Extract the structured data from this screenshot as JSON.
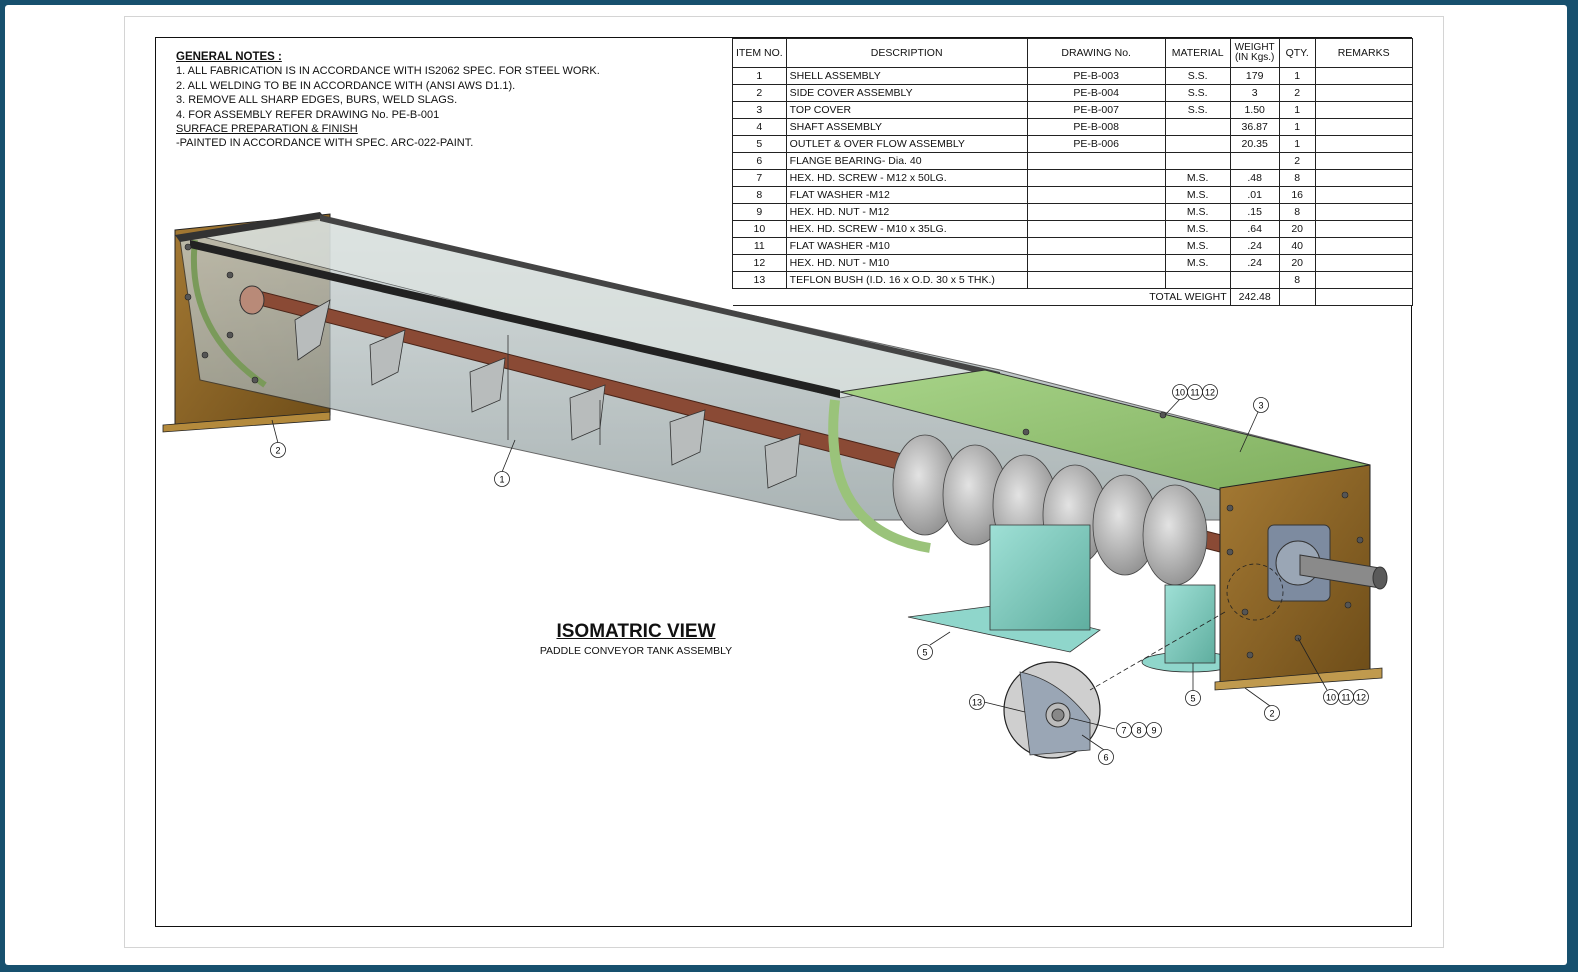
{
  "general_notes": {
    "heading": "GENERAL NOTES :",
    "items": [
      "1.  ALL FABRICATION IS IN ACCORDANCE WITH IS2062 SPEC. FOR STEEL WORK.",
      "2.  ALL WELDING TO BE IN ACCORDANCE WITH (ANSI AWS D1.1).",
      "3.  REMOVE ALL SHARP EDGES, BURS, WELD SLAGS.",
      "4.  FOR ASSEMBLY REFER DRAWING No. PE-B-001"
    ],
    "finish_heading": "SURFACE PREPARATION & FINISH",
    "finish_text": "-PAINTED IN ACCORDANCE WITH SPEC. ARC-022-PAINT."
  },
  "bom": {
    "headers": {
      "item": "ITEM NO.",
      "description": "DESCRIPTION",
      "drawing": "DRAWING No.",
      "material": "MATERIAL",
      "weight_1": "WEIGHT",
      "weight_2": "(IN Kgs.)",
      "qty": "QTY.",
      "remarks": "REMARKS"
    },
    "rows": [
      {
        "item": "1",
        "description": "SHELL ASSEMBLY",
        "drawing": "PE-B-003",
        "material": "S.S.",
        "weight": "179",
        "qty": "1",
        "remarks": ""
      },
      {
        "item": "2",
        "description": "SIDE COVER ASSEMBLY",
        "drawing": "PE-B-004",
        "material": "S.S.",
        "weight": "3",
        "qty": "2",
        "remarks": ""
      },
      {
        "item": "3",
        "description": "TOP COVER",
        "drawing": "PE-B-007",
        "material": "S.S.",
        "weight": "1.50",
        "qty": "1",
        "remarks": ""
      },
      {
        "item": "4",
        "description": "SHAFT ASSEMBLY",
        "drawing": "PE-B-008",
        "material": "",
        "weight": "36.87",
        "qty": "1",
        "remarks": ""
      },
      {
        "item": "5",
        "description": "OUTLET & OVER FLOW ASSEMBLY",
        "drawing": "PE-B-006",
        "material": "",
        "weight": "20.35",
        "qty": "1",
        "remarks": ""
      },
      {
        "item": "6",
        "description": "FLANGE BEARING- Dia. 40",
        "drawing": "",
        "material": "",
        "weight": "",
        "qty": "2",
        "remarks": ""
      },
      {
        "item": "7",
        "description": "HEX. HD. SCREW - M12 x 50LG.",
        "drawing": "",
        "material": "M.S.",
        "weight": ".48",
        "qty": "8",
        "remarks": ""
      },
      {
        "item": "8",
        "description": "FLAT WASHER -M12",
        "drawing": "",
        "material": "M.S.",
        "weight": ".01",
        "qty": "16",
        "remarks": ""
      },
      {
        "item": "9",
        "description": "HEX. HD. NUT - M12",
        "drawing": "",
        "material": "M.S.",
        "weight": ".15",
        "qty": "8",
        "remarks": ""
      },
      {
        "item": "10",
        "description": "HEX. HD. SCREW - M10 x 35LG.",
        "drawing": "",
        "material": "M.S.",
        "weight": ".64",
        "qty": "20",
        "remarks": ""
      },
      {
        "item": "11",
        "description": "FLAT WASHER -M10",
        "drawing": "",
        "material": "M.S.",
        "weight": ".24",
        "qty": "40",
        "remarks": ""
      },
      {
        "item": "12",
        "description": "HEX. HD. NUT - M10",
        "drawing": "",
        "material": "M.S.",
        "weight": ".24",
        "qty": "20",
        "remarks": ""
      },
      {
        "item": "13",
        "description": "TEFLON BUSH (I.D. 16 x O.D. 30 x 5 THK.)",
        "drawing": "",
        "material": "",
        "weight": "",
        "qty": "8",
        "remarks": ""
      }
    ],
    "total_label": "TOTAL WEIGHT",
    "total_value": "242.48"
  },
  "view": {
    "title": "ISOMATRIC VIEW",
    "subtitle": "PADDLE CONVEYOR TANK ASSEMBLY"
  },
  "balloons": {
    "b1": "1",
    "b2a": "2",
    "b2b": "2",
    "b3": "3",
    "b5a": "5",
    "b5b": "5",
    "b6": "6",
    "b13": "13",
    "g_top_10": "10",
    "g_top_11": "11",
    "g_top_12": "12",
    "g_bot_10": "10",
    "g_bot_11": "11",
    "g_bot_12": "12",
    "g_7": "7",
    "g_8": "8",
    "g_9": "9"
  },
  "colors": {
    "background": "#17506e",
    "shell_glass": "#9aa7a8",
    "top_cover": "#8fbf6e",
    "side_plate": "#8a6424",
    "shaft": "#8a4a35",
    "outlet": "#7fc9bf"
  }
}
